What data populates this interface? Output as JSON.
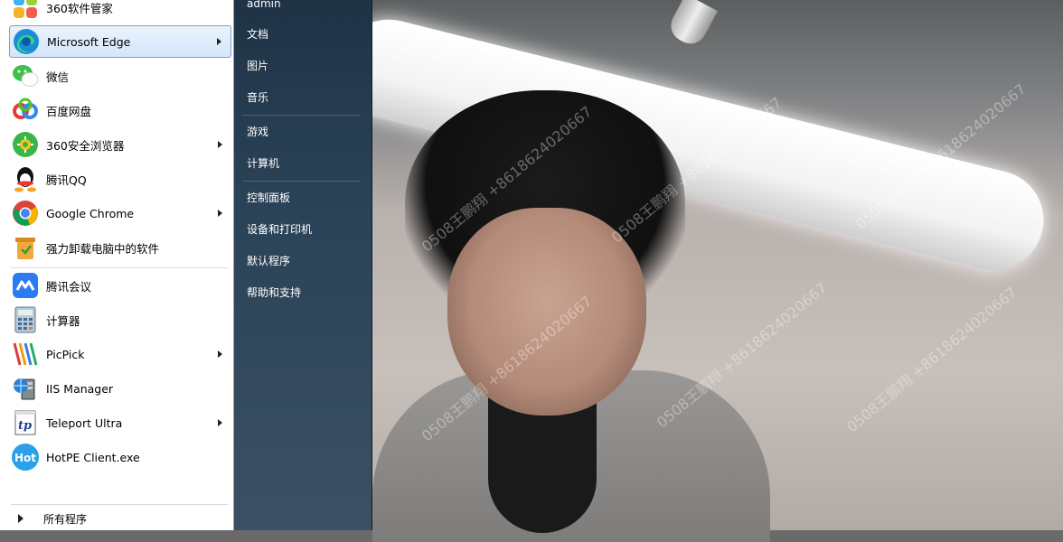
{
  "programs": [
    {
      "label": "360软件管家",
      "icon": "360-software-manager-icon",
      "arrow": false
    },
    {
      "label": "Microsoft Edge",
      "icon": "edge-icon",
      "arrow": true,
      "highlight": true
    },
    {
      "label": "微信",
      "icon": "wechat-icon",
      "arrow": false
    },
    {
      "label": "百度网盘",
      "icon": "baidu-netdisk-icon",
      "arrow": false
    },
    {
      "label": "360安全浏览器",
      "icon": "360-browser-icon",
      "arrow": true
    },
    {
      "label": "腾讯QQ",
      "icon": "qq-icon",
      "arrow": false
    },
    {
      "label": "Google Chrome",
      "icon": "chrome-icon",
      "arrow": true
    },
    {
      "label": "强力卸载电脑中的软件",
      "icon": "uninstall-icon",
      "arrow": false
    },
    {
      "label": "腾讯会议",
      "icon": "tencent-meeting-icon",
      "arrow": false
    },
    {
      "label": "计算器",
      "icon": "calculator-icon",
      "arrow": false
    },
    {
      "label": "PicPick",
      "icon": "picpick-icon",
      "arrow": true
    },
    {
      "label": "IIS Manager",
      "icon": "iis-manager-icon",
      "arrow": false
    },
    {
      "label": "Teleport Ultra",
      "icon": "teleport-icon",
      "arrow": true
    },
    {
      "label": "HotPE Client.exe",
      "icon": "hotpe-icon",
      "arrow": false
    }
  ],
  "all_programs_label": "所有程序",
  "right_items": [
    {
      "label": "admin"
    },
    {
      "label": "文档"
    },
    {
      "label": "图片"
    },
    {
      "label": "音乐"
    },
    {
      "label": "游戏"
    },
    {
      "label": "计算机"
    },
    {
      "label": "控制面板"
    },
    {
      "label": "设备和打印机"
    },
    {
      "label": "默认程序"
    },
    {
      "label": "帮助和支持"
    }
  ],
  "hotpe_icon_text": "Hot",
  "teleport_icon_text": "tp",
  "watermark_text": "0508王鹏翔 +8618624020667",
  "colors": {
    "highlight_border": "#7da2ce",
    "right_panel": "#2b4358"
  }
}
